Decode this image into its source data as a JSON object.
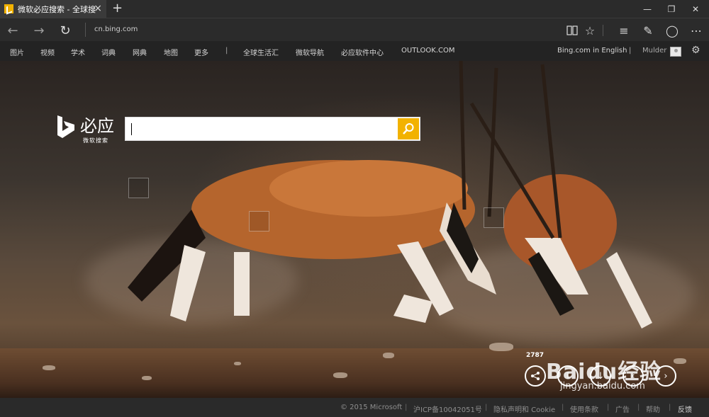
{
  "tab": {
    "title": "微软必应搜索 - 全球搜索",
    "close": "×",
    "new_tab": "+"
  },
  "window": {
    "minimize": "—",
    "restore": "❐",
    "close": "✕"
  },
  "address": {
    "url": "cn.bing.com"
  },
  "bing_nav": {
    "items": [
      "图片",
      "视频",
      "学术",
      "词典",
      "网典",
      "地图",
      "更多",
      "|",
      "全球生活汇",
      "微软导航",
      "必应软件中心",
      "OUTLOOK.COM"
    ],
    "english": "Bing.com in English",
    "separator": "|",
    "user": "Mulder"
  },
  "logo": {
    "name": "必应",
    "subtitle": "微软搜索"
  },
  "search": {
    "value": "",
    "placeholder": ""
  },
  "image_actions": {
    "count": "2787"
  },
  "watermark": {
    "text": "Baidu经验",
    "sub": "jingyan.baidu.com"
  },
  "footer": {
    "items": [
      "© 2015 Microsoft",
      "沪ICP备10042051号",
      "隐私声明和 Cookie",
      "使用条款",
      "广告",
      "帮助",
      "反馈"
    ],
    "separator": "|"
  },
  "colors": {
    "accent": "#f2b200"
  }
}
